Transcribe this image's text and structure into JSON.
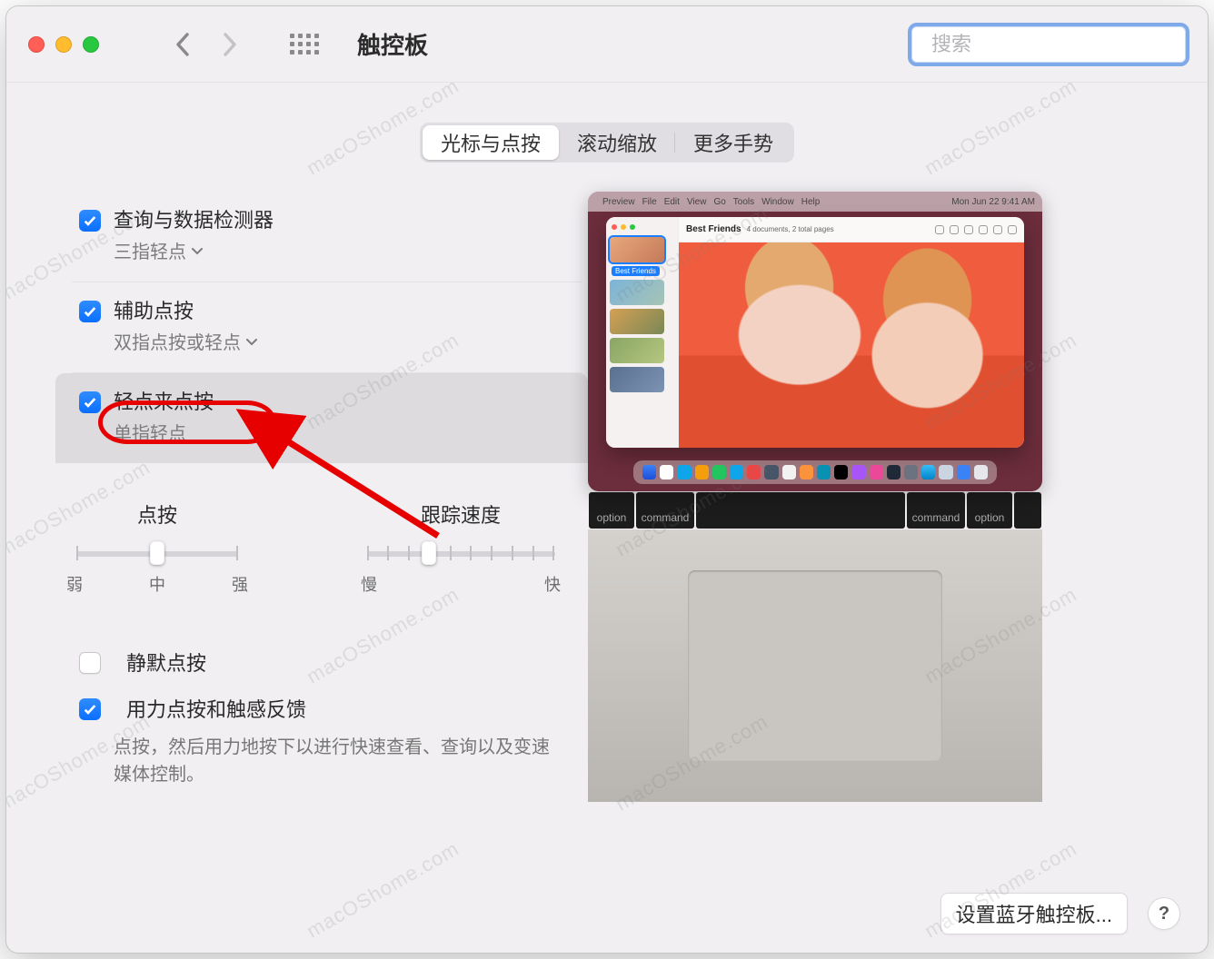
{
  "window": {
    "title": "触控板",
    "watermark_text": "macOShome.com"
  },
  "search": {
    "placeholder": "搜索"
  },
  "tabs": [
    {
      "label": "光标与点按",
      "active": true
    },
    {
      "label": "滚动缩放",
      "active": false
    },
    {
      "label": "更多手势",
      "active": false
    }
  ],
  "options": {
    "lookup": {
      "label": "查询与数据检测器",
      "sub": "三指轻点",
      "checked": true
    },
    "secondary": {
      "label": "辅助点按",
      "sub": "双指点按或轻点",
      "checked": true
    },
    "tap_to_click": {
      "label": "轻点来点按",
      "sub": "单指轻点",
      "checked": true
    },
    "silent": {
      "label": "静默点按",
      "checked": false
    },
    "force": {
      "label": "用力点按和触感反馈",
      "desc": "点按，然后用力地按下以进行快速查看、查询以及变速媒体控制。",
      "checked": true
    }
  },
  "sliders": {
    "click": {
      "title": "点按",
      "min_label": "弱",
      "mid_label": "中",
      "max_label": "强",
      "ticks": 3,
      "value_index": 1
    },
    "tracking": {
      "title": "跟踪速度",
      "min_label": "慢",
      "max_label": "快",
      "ticks": 10,
      "value_index": 3
    }
  },
  "preview": {
    "menu_items": [
      "Preview",
      "File",
      "Edit",
      "View",
      "Go",
      "Tools",
      "Window",
      "Help"
    ],
    "menu_right": "Mon Jun 22  9:41 AM",
    "win_title": "Best Friends",
    "win_subtitle": "4 documents, 2 total pages",
    "selection_label": "Best Friends",
    "keys": [
      "option",
      "command",
      "",
      "",
      "command",
      "option"
    ]
  },
  "footer": {
    "bluetooth_button": "设置蓝牙触控板...",
    "help_label": "?"
  }
}
